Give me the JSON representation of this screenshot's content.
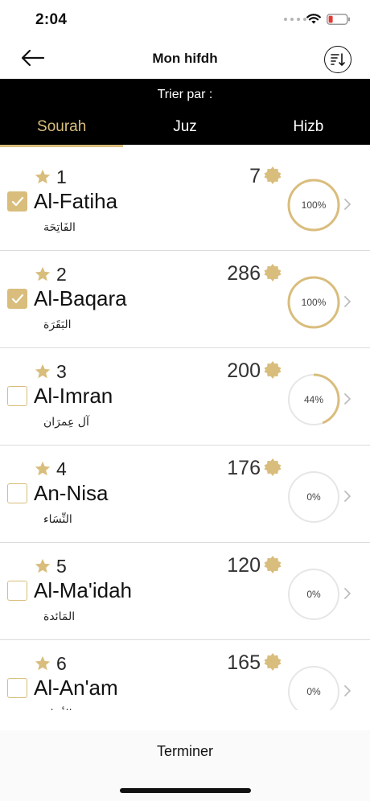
{
  "status_bar": {
    "time": "2:04"
  },
  "nav": {
    "title": "Mon hifdh"
  },
  "sort": {
    "caption": "Trier par :",
    "tabs": [
      {
        "label": "Sourah",
        "active": true
      },
      {
        "label": "Juz",
        "active": false
      },
      {
        "label": "Hizb",
        "active": false
      }
    ]
  },
  "accent_color": "#d9bd7c",
  "suras": [
    {
      "number": "1",
      "name": "Al-Fatiha",
      "arabic": "الفَاتِحَة",
      "verses": "7",
      "progress_label": "100%",
      "progress": 1.0,
      "checked": true
    },
    {
      "number": "2",
      "name": "Al-Baqara",
      "arabic": "البَقَرَة",
      "verses": "286",
      "progress_label": "100%",
      "progress": 1.0,
      "checked": true
    },
    {
      "number": "3",
      "name": "Al-Imran",
      "arabic": "آل عِمرَان",
      "verses": "200",
      "progress_label": "44%",
      "progress": 0.44,
      "checked": false
    },
    {
      "number": "4",
      "name": "An-Nisa",
      "arabic": "النِّسَاء",
      "verses": "176",
      "progress_label": "0%",
      "progress": 0,
      "checked": false
    },
    {
      "number": "5",
      "name": "Al-Ma'idah",
      "arabic": "المَائدة",
      "verses": "120",
      "progress_label": "0%",
      "progress": 0,
      "checked": false
    },
    {
      "number": "6",
      "name": "Al-An'am",
      "arabic": "الأنعَام",
      "verses": "165",
      "progress_label": "0%",
      "progress": 0,
      "checked": false
    }
  ],
  "footer": {
    "done_label": "Terminer"
  }
}
